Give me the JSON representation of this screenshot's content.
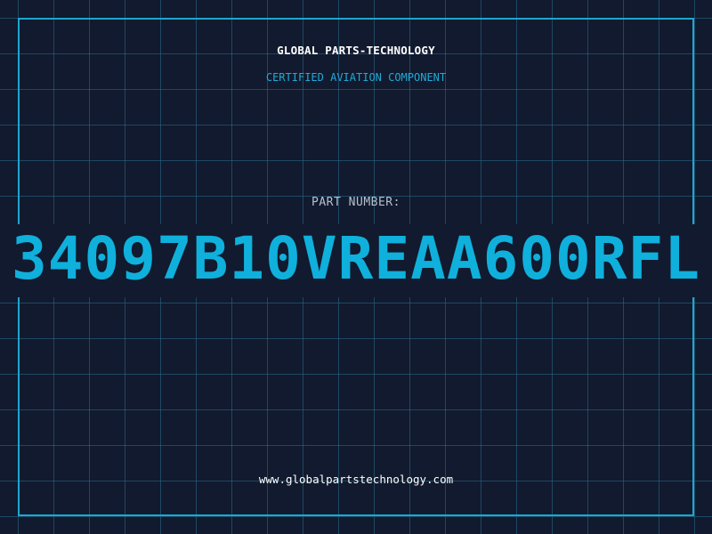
{
  "brand": {
    "name": "GLOBAL PARTS-TECHNOLOGY",
    "tagline": "CERTIFIED AVIATION COMPONENT"
  },
  "part": {
    "label": "PART NUMBER:",
    "number": "34097B10VREAA600RFL"
  },
  "footer": {
    "website": "www.globalpartstechnology.com"
  },
  "colors": {
    "background": "#111a2e",
    "grid": "#286e8c",
    "accent": "#0fb0dc",
    "text": "#ffffff",
    "label": "#b8c0cc"
  }
}
